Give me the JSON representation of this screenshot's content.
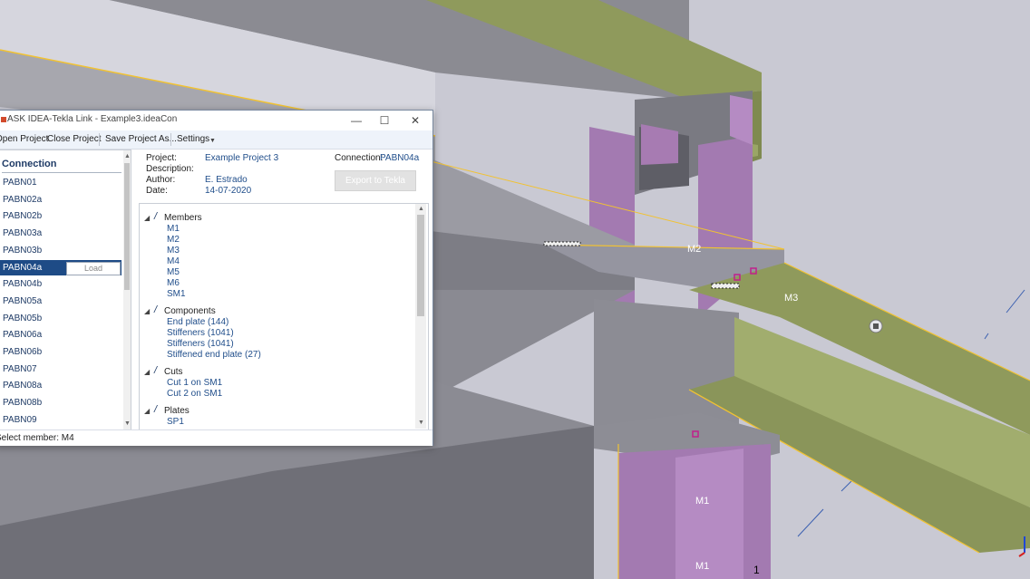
{
  "window": {
    "title": "ASK IDEA-Tekla Link  -  Example3.ideaCon",
    "minimize_icon": "minimize-icon",
    "maximize_icon": "maximize-icon",
    "close_icon": "close-icon"
  },
  "menu": {
    "open_label": "Open Project",
    "close_label": "Close Project",
    "save_as_label": "Save Project As...",
    "settings_label": "Settings"
  },
  "connection_list": {
    "header": "Connection",
    "items": [
      {
        "label": "PABN01"
      },
      {
        "label": "PABN02a"
      },
      {
        "label": "PABN02b"
      },
      {
        "label": "PABN03a"
      },
      {
        "label": "PABN03b"
      },
      {
        "label": "PABN04a",
        "selected": true,
        "action": "Load"
      },
      {
        "label": "PABN04b"
      },
      {
        "label": "PABN05a"
      },
      {
        "label": "PABN05b"
      },
      {
        "label": "PABN06a"
      },
      {
        "label": "PABN06b"
      },
      {
        "label": "PABN07"
      },
      {
        "label": "PABN08a"
      },
      {
        "label": "PABN08b"
      },
      {
        "label": "PABN09"
      }
    ]
  },
  "project_info": {
    "project_label": "Project:",
    "project_value": "Example Project 3",
    "description_label": "Description:",
    "description_value": "",
    "author_label": "Author:",
    "author_value": "E. Estrado",
    "date_label": "Date:",
    "date_value": "14-07-2020",
    "connection_label": "Connection:",
    "connection_value": "PABN04a",
    "export_button": "Export to Tekla"
  },
  "tree": {
    "groups": [
      {
        "label": "Members",
        "children": [
          "M1",
          "M2",
          "M3",
          "M4",
          "M5",
          "M6",
          "SM1"
        ]
      },
      {
        "label": "Components",
        "children": [
          "End plate (144)",
          "Stiffeners (1041)",
          "Stiffeners (1041)",
          "Stiffened end plate (27)"
        ]
      },
      {
        "label": "Cuts",
        "children": [
          "Cut 1 on SM1",
          "Cut 2 on SM1"
        ]
      },
      {
        "label": "Plates",
        "children": [
          "SP1"
        ]
      }
    ]
  },
  "status": {
    "text": "Select member: M4"
  },
  "viewport": {
    "labels": {
      "m2": "M2",
      "m3": "M3",
      "m1_upper": "M1",
      "m1_lower": "M1",
      "number": "1"
    },
    "colors": {
      "steel_grey": "#8e8e96",
      "beam_olive": "#8f9a5c",
      "column_violet": "#a37ab1",
      "highlight_yellow": "#f1c232",
      "background": "#c9c9d3"
    }
  }
}
